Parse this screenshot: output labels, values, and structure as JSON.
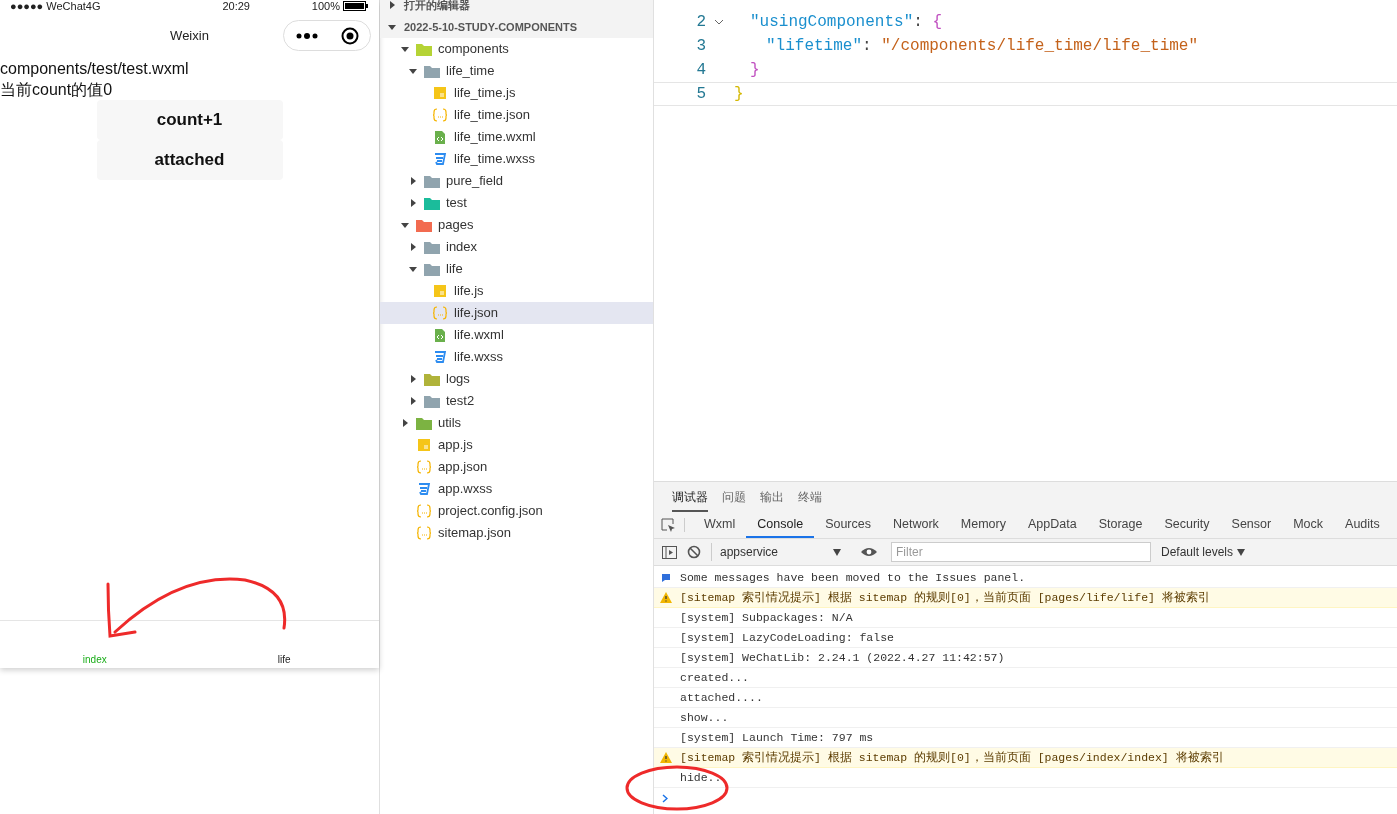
{
  "simulator": {
    "status_bar": {
      "carrier": "●●●●● WeChat4G",
      "time": "20:29",
      "battery": "100%"
    },
    "nav_title": "Weixin",
    "lines": [
      "components/test/test.wxml",
      "当前count的值0"
    ],
    "buttons": [
      "count+1",
      "attached"
    ],
    "tab_bar": [
      {
        "label": "index",
        "selected": true
      },
      {
        "label": "life",
        "selected": false
      }
    ]
  },
  "explorer": {
    "sections": [
      {
        "label": "打开的编辑器",
        "expanded": false
      },
      {
        "label": "2022-5-10-STUDY-COMPONENTS",
        "expanded": true
      }
    ],
    "tree": [
      {
        "name": "components",
        "kind": "folder",
        "color": "#b5d335",
        "expanded": true,
        "selected": false,
        "children": [
          {
            "name": "life_time",
            "kind": "folder",
            "color": "#90a4ae",
            "expanded": true,
            "selected": false,
            "children": [
              {
                "name": "life_time.js",
                "kind": "js",
                "selected": false
              },
              {
                "name": "life_time.json",
                "kind": "json",
                "selected": false
              },
              {
                "name": "life_time.wxml",
                "kind": "wxml",
                "selected": false
              },
              {
                "name": "life_time.wxss",
                "kind": "wxss",
                "selected": false
              }
            ]
          },
          {
            "name": "pure_field",
            "kind": "folder",
            "color": "#90a4ae",
            "expanded": false,
            "selected": false
          },
          {
            "name": "test",
            "kind": "folder",
            "color": "#1bbc9b",
            "expanded": false,
            "selected": false
          }
        ]
      },
      {
        "name": "pages",
        "kind": "folder",
        "color": "#f26b50",
        "expanded": true,
        "selected": false,
        "children": [
          {
            "name": "index",
            "kind": "folder",
            "color": "#90a4ae",
            "expanded": false,
            "selected": false
          },
          {
            "name": "life",
            "kind": "folder",
            "color": "#90a4ae",
            "expanded": true,
            "selected": false,
            "children": [
              {
                "name": "life.js",
                "kind": "js",
                "selected": false
              },
              {
                "name": "life.json",
                "kind": "json",
                "selected": true
              },
              {
                "name": "life.wxml",
                "kind": "wxml",
                "selected": false
              },
              {
                "name": "life.wxss",
                "kind": "wxss",
                "selected": false
              }
            ]
          },
          {
            "name": "logs",
            "kind": "folder",
            "color": "#b0b33a",
            "expanded": false,
            "selected": false
          },
          {
            "name": "test2",
            "kind": "folder",
            "color": "#90a4ae",
            "expanded": false,
            "selected": false
          }
        ]
      },
      {
        "name": "utils",
        "kind": "folder",
        "color": "#7cb342",
        "expanded": false,
        "selected": false
      },
      {
        "name": "app.js",
        "kind": "js",
        "selected": false
      },
      {
        "name": "app.json",
        "kind": "json",
        "selected": false
      },
      {
        "name": "app.wxss",
        "kind": "wxss",
        "selected": false
      },
      {
        "name": "project.config.json",
        "kind": "json",
        "selected": false
      },
      {
        "name": "sitemap.json",
        "kind": "json",
        "selected": false
      }
    ]
  },
  "editor": {
    "lines": [
      {
        "number": "2",
        "foldable": true,
        "current": false,
        "tokens": [
          {
            "kind": "key",
            "text": "\"usingComponents\""
          },
          {
            "kind": "punct",
            "text": ": "
          },
          {
            "kind": "brace",
            "text": "{"
          }
        ]
      },
      {
        "number": "3",
        "foldable": false,
        "current": false,
        "tokens": [
          {
            "kind": "key",
            "text": "\"lifetime\""
          },
          {
            "kind": "punct",
            "text": ": "
          },
          {
            "kind": "string",
            "text": "\"/components/life_time/life_time\""
          }
        ]
      },
      {
        "number": "4",
        "foldable": false,
        "current": false,
        "tokens": [
          {
            "kind": "brace",
            "text": "}"
          }
        ]
      },
      {
        "number": "5",
        "foldable": false,
        "current": true,
        "tokens": [
          {
            "kind": "root",
            "text": "}"
          }
        ]
      }
    ]
  },
  "devtools": {
    "panel_tabs": [
      {
        "label": "调试器",
        "selected": true
      },
      {
        "label": "问题",
        "selected": false
      },
      {
        "label": "输出",
        "selected": false
      },
      {
        "label": "终端",
        "selected": false
      }
    ],
    "tool_tabs": [
      {
        "label": "Wxml",
        "selected": false
      },
      {
        "label": "Console",
        "selected": true
      },
      {
        "label": "Sources",
        "selected": false
      },
      {
        "label": "Network",
        "selected": false
      },
      {
        "label": "Memory",
        "selected": false
      },
      {
        "label": "AppData",
        "selected": false
      },
      {
        "label": "Storage",
        "selected": false
      },
      {
        "label": "Security",
        "selected": false
      },
      {
        "label": "Sensor",
        "selected": false
      },
      {
        "label": "Mock",
        "selected": false
      },
      {
        "label": "Audits",
        "selected": false
      }
    ],
    "context": "appservice",
    "filter_placeholder": "Filter",
    "levels": "Default levels",
    "messages": [
      {
        "kind": "info",
        "text": "Some messages have been moved to the Issues panel."
      },
      {
        "kind": "warning",
        "text": "[sitemap 索引情况提示] 根据 sitemap 的规则[0]，当前页面 [pages/life/life] 将被索引"
      },
      {
        "kind": "log",
        "text": "[system] Subpackages: N/A"
      },
      {
        "kind": "log",
        "text": "[system] LazyCodeLoading: false"
      },
      {
        "kind": "log",
        "text": "[system] WeChatLib: 2.24.1 (2022.4.27 11:42:57)"
      },
      {
        "kind": "log",
        "text": "created..."
      },
      {
        "kind": "log",
        "text": "attached...."
      },
      {
        "kind": "log",
        "text": "show..."
      },
      {
        "kind": "log",
        "text": "[system] Launch Time: 797 ms"
      },
      {
        "kind": "warning",
        "text": "[sitemap 索引情况提示] 根据 sitemap 的规则[0]，当前页面 [pages/index/index] 将被索引"
      },
      {
        "kind": "log",
        "text": "hide.."
      }
    ]
  }
}
